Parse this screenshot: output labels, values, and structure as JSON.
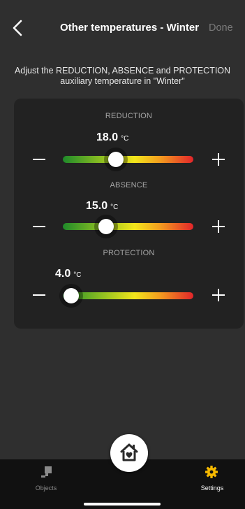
{
  "header": {
    "title": "Other temperatures - Winter",
    "done_label": "Done",
    "back_icon": "chevron-left-icon"
  },
  "instruction": "Adjust the REDUCTION, ABSENCE and PROTECTION auxiliary temperature in \"Winter\"",
  "sliders": [
    {
      "label": "REDUCTION",
      "value": "18.0",
      "unit": "°C",
      "position": 0.4
    },
    {
      "label": "ABSENCE",
      "value": "15.0",
      "unit": "°C",
      "position": 0.33
    },
    {
      "label": "PROTECTION",
      "value": "4.0",
      "unit": "°C",
      "position": 0.07
    }
  ],
  "tabbar": {
    "objects_label": "Objects",
    "settings_label": "Settings",
    "center_icon": "home-heart-icon",
    "active_color": "#f5b800",
    "inactive_color": "#8a8a8a"
  }
}
